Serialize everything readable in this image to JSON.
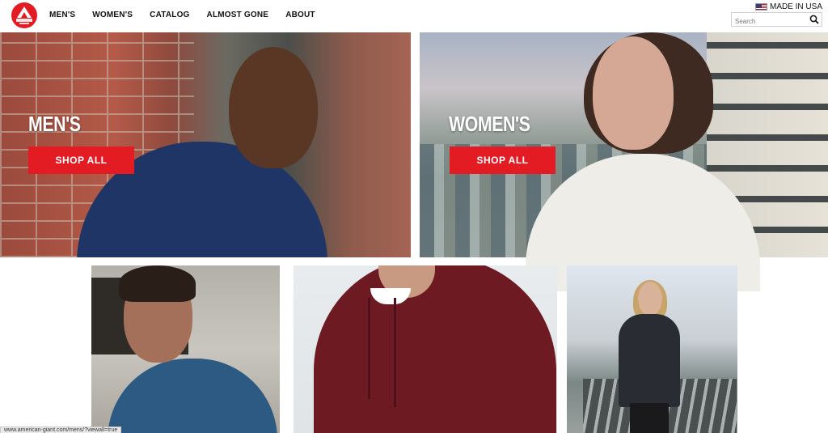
{
  "logo": {
    "text": "AMERICAN GIANT",
    "icon": "american-giant-logo"
  },
  "nav": {
    "items": [
      "MEN'S",
      "WOMEN'S",
      "CATALOG",
      "ALMOST GONE",
      "ABOUT"
    ]
  },
  "header": {
    "made_in": "MADE IN USA",
    "flag_icon": "us-flag-icon",
    "search_placeholder": "Search",
    "search_icon": "search-icon"
  },
  "hero": {
    "men": {
      "title": "MEN'S",
      "button": "SHOP ALL"
    },
    "women": {
      "title": "WOMEN'S",
      "button": "SHOP ALL"
    }
  },
  "status_bar": {
    "url": "www.american-giant.com/mens/?viewall=true"
  },
  "colors": {
    "brand_red": "#e31b23",
    "text_dark": "#111111"
  }
}
